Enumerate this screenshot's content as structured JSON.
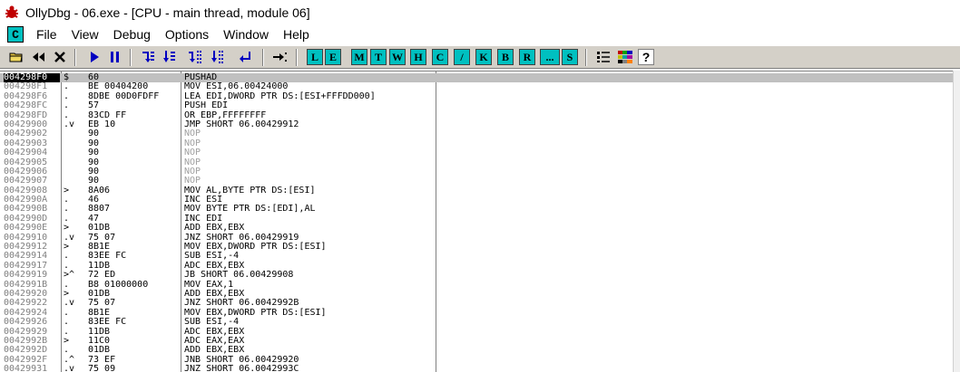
{
  "window": {
    "title": "OllyDbg - 06.exe - [CPU - main thread, module 06]"
  },
  "menu": {
    "c_icon_label": "C",
    "items": [
      "File",
      "View",
      "Debug",
      "Options",
      "Window",
      "Help"
    ]
  },
  "toolbar": {
    "icons": [
      "open-icon",
      "restart-icon",
      "close-icon",
      "run-icon",
      "pause-icon",
      "step-into-icon",
      "step-over-icon",
      "trace-into-icon",
      "trace-over-icon",
      "execute-till-return-icon",
      "goto-icon"
    ],
    "window_buttons": [
      "L",
      "E",
      "M",
      "T",
      "W",
      "H",
      "C",
      "/",
      "K",
      "B",
      "R",
      "...",
      "S"
    ],
    "trailing_icons": [
      "appearance-icon",
      "colors-icon",
      "help-icon"
    ]
  },
  "colors": {
    "toolbar_bg": "#d4d0c8",
    "letter_button": "#00c0c0",
    "selection_bg": "#c0c0c0",
    "address_text": "#808080",
    "nop_text": "#a0a0a0"
  },
  "disassembly": {
    "selected_index": 0,
    "rows": [
      {
        "addr": "004298F0",
        "mark": "$",
        "hex": "60",
        "asm": "PUSHAD"
      },
      {
        "addr": "004298F1",
        "mark": ".",
        "hex": "BE 00404200",
        "asm": "MOV ESI,06.00424000"
      },
      {
        "addr": "004298F6",
        "mark": ".",
        "hex": "8DBE 00D0FDFF",
        "asm": "LEA EDI,DWORD PTR DS:[ESI+FFFDD000]"
      },
      {
        "addr": "004298FC",
        "mark": ".",
        "hex": "57",
        "asm": "PUSH EDI"
      },
      {
        "addr": "004298FD",
        "mark": ".",
        "hex": "83CD FF",
        "asm": "OR EBP,FFFFFFFF"
      },
      {
        "addr": "00429900",
        "mark": ".v",
        "hex": "EB 10",
        "asm": "JMP SHORT 06.00429912"
      },
      {
        "addr": "00429902",
        "mark": "",
        "hex": "90",
        "asm": "NOP"
      },
      {
        "addr": "00429903",
        "mark": "",
        "hex": "90",
        "asm": "NOP"
      },
      {
        "addr": "00429904",
        "mark": "",
        "hex": "90",
        "asm": "NOP"
      },
      {
        "addr": "00429905",
        "mark": "",
        "hex": "90",
        "asm": "NOP"
      },
      {
        "addr": "00429906",
        "mark": "",
        "hex": "90",
        "asm": "NOP"
      },
      {
        "addr": "00429907",
        "mark": "",
        "hex": "90",
        "asm": "NOP"
      },
      {
        "addr": "00429908",
        "mark": ">",
        "hex": "8A06",
        "asm": "MOV AL,BYTE PTR DS:[ESI]"
      },
      {
        "addr": "0042990A",
        "mark": ".",
        "hex": "46",
        "asm": "INC ESI"
      },
      {
        "addr": "0042990B",
        "mark": ".",
        "hex": "8807",
        "asm": "MOV BYTE PTR DS:[EDI],AL"
      },
      {
        "addr": "0042990D",
        "mark": ".",
        "hex": "47",
        "asm": "INC EDI"
      },
      {
        "addr": "0042990E",
        "mark": ">",
        "hex": "01DB",
        "asm": "ADD EBX,EBX"
      },
      {
        "addr": "00429910",
        "mark": ".v",
        "hex": "75 07",
        "asm": "JNZ SHORT 06.00429919"
      },
      {
        "addr": "00429912",
        "mark": ">",
        "hex": "8B1E",
        "asm": "MOV EBX,DWORD PTR DS:[ESI]"
      },
      {
        "addr": "00429914",
        "mark": ".",
        "hex": "83EE FC",
        "asm": "SUB ESI,-4"
      },
      {
        "addr": "00429917",
        "mark": ".",
        "hex": "11DB",
        "asm": "ADC EBX,EBX"
      },
      {
        "addr": "00429919",
        "mark": ">^",
        "hex": "72 ED",
        "asm": "JB SHORT 06.00429908"
      },
      {
        "addr": "0042991B",
        "mark": ".",
        "hex": "B8 01000000",
        "asm": "MOV EAX,1"
      },
      {
        "addr": "00429920",
        "mark": ">",
        "hex": "01DB",
        "asm": "ADD EBX,EBX"
      },
      {
        "addr": "00429922",
        "mark": ".v",
        "hex": "75 07",
        "asm": "JNZ SHORT 06.0042992B"
      },
      {
        "addr": "00429924",
        "mark": ".",
        "hex": "8B1E",
        "asm": "MOV EBX,DWORD PTR DS:[ESI]"
      },
      {
        "addr": "00429926",
        "mark": ".",
        "hex": "83EE FC",
        "asm": "SUB ESI,-4"
      },
      {
        "addr": "00429929",
        "mark": ".",
        "hex": "11DB",
        "asm": "ADC EBX,EBX"
      },
      {
        "addr": "0042992B",
        "mark": ">",
        "hex": "11C0",
        "asm": "ADC EAX,EAX"
      },
      {
        "addr": "0042992D",
        "mark": ".",
        "hex": "01DB",
        "asm": "ADD EBX,EBX"
      },
      {
        "addr": "0042992F",
        "mark": ".^",
        "hex": "73 EF",
        "asm": "JNB SHORT 06.00429920"
      },
      {
        "addr": "00429931",
        "mark": ".v",
        "hex": "75 09",
        "asm": "JNZ SHORT 06.0042993C"
      }
    ]
  }
}
